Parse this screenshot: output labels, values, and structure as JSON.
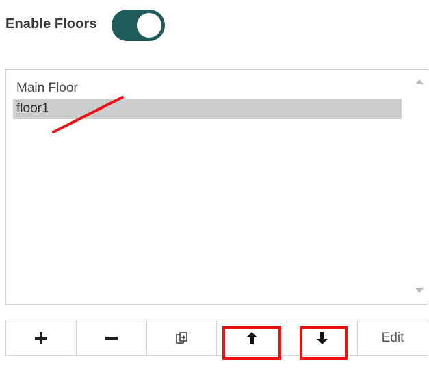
{
  "settings": {
    "enable_floors_label": "Enable Floors",
    "enable_floors_on": true
  },
  "floors": {
    "items": [
      {
        "label": "Main Floor",
        "selected": false
      },
      {
        "label": "floor1",
        "selected": true
      }
    ]
  },
  "toolbar": {
    "add_icon": "plus-icon",
    "remove_icon": "minus-icon",
    "duplicate_icon": "copy-icon",
    "move_up_icon": "arrow-up-icon",
    "move_down_icon": "arrow-down-icon",
    "edit_label": "Edit"
  },
  "colors": {
    "toggle_on": "#1f5c5a",
    "selection": "#cdcdcd",
    "annotation": "#ee1111"
  }
}
